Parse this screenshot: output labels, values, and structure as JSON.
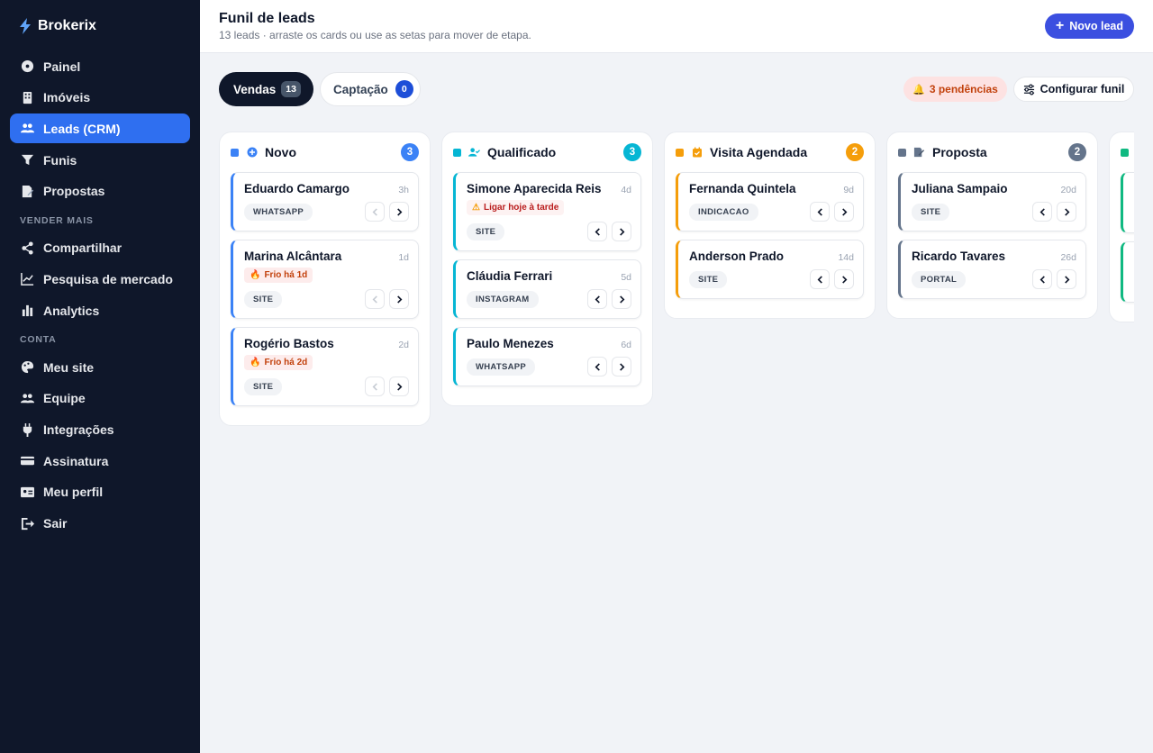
{
  "brand": {
    "name": "Brokerix",
    "icon": "bolt-icon"
  },
  "sidebar": {
    "items": [
      {
        "label": "Painel",
        "icon": "dashboard-icon"
      },
      {
        "label": "Imóveis",
        "icon": "building-icon"
      },
      {
        "label": "Leads (CRM)",
        "icon": "users-icon",
        "active": true
      },
      {
        "label": "Funis",
        "icon": "filter-icon"
      },
      {
        "label": "Propostas",
        "icon": "document-edit-icon"
      }
    ],
    "section_vender": "VENDER MAIS",
    "vender_items": [
      {
        "label": "Compartilhar",
        "icon": "share-icon"
      },
      {
        "label": "Pesquisa de mercado",
        "icon": "chart-line-icon"
      },
      {
        "label": "Analytics",
        "icon": "chart-bar-icon"
      }
    ],
    "section_conta": "CONTA",
    "conta_items": [
      {
        "label": "Meu site",
        "icon": "palette-icon"
      },
      {
        "label": "Equipe",
        "icon": "team-icon"
      },
      {
        "label": "Integrações",
        "icon": "plug-icon"
      },
      {
        "label": "Assinatura",
        "icon": "credit-card-icon"
      },
      {
        "label": "Meu perfil",
        "icon": "id-card-icon"
      },
      {
        "label": "Sair",
        "icon": "logout-icon"
      }
    ]
  },
  "header": {
    "title": "Funil de leads",
    "subtitle": "13 leads · arraste os cards ou use as setas para mover de etapa.",
    "new_lead_label": "Novo lead"
  },
  "toolbar": {
    "tab_vendas": {
      "label": "Vendas",
      "count": "13"
    },
    "tab_captacao": {
      "label": "Captação",
      "count": "0"
    },
    "pendencias_label": "3 pendências",
    "config_label": "Configurar funil"
  },
  "colors": {
    "novo": "#3b82f6",
    "qualificado": "#06b6d4",
    "visita": "#f59e0b",
    "proposta": "#64748b",
    "fechado": "#10b981",
    "primary": "#2f6ff0",
    "sidebar_bg": "#0f172a"
  },
  "columns": [
    {
      "title": "Novo",
      "count": "3",
      "icon": "plus-circle-icon",
      "cards": [
        {
          "name": "Eduardo Camargo",
          "age": "3h",
          "tag": "WHATSAPP",
          "alert": ""
        },
        {
          "name": "Marina Alcântara",
          "age": "1d",
          "tag": "SITE",
          "alert": "Frio há 1d"
        },
        {
          "name": "Rogério Bastos",
          "age": "2d",
          "tag": "SITE",
          "alert": "Frio há 2d"
        }
      ]
    },
    {
      "title": "Qualificado",
      "count": "3",
      "icon": "user-check-icon",
      "cards": [
        {
          "name": "Simone Aparecida Reis",
          "age": "4d",
          "tag": "SITE",
          "alert": "Ligar hoje à tarde"
        },
        {
          "name": "Cláudia Ferrari",
          "age": "5d",
          "tag": "INSTAGRAM",
          "alert": ""
        },
        {
          "name": "Paulo Menezes",
          "age": "6d",
          "tag": "WHATSAPP",
          "alert": ""
        }
      ]
    },
    {
      "title": "Visita Agendada",
      "count": "2",
      "icon": "calendar-check-icon",
      "cards": [
        {
          "name": "Fernanda Quintela",
          "age": "9d",
          "tag": "INDICACAO",
          "alert": ""
        },
        {
          "name": "Anderson Prado",
          "age": "14d",
          "tag": "SITE",
          "alert": ""
        }
      ]
    },
    {
      "title": "Proposta",
      "count": "2",
      "icon": "document-edit-icon",
      "cards": [
        {
          "name": "Juliana Sampaio",
          "age": "20d",
          "tag": "SITE",
          "alert": ""
        },
        {
          "name": "Ricardo Tavares",
          "age": "26d",
          "tag": "PORTAL",
          "alert": ""
        }
      ]
    }
  ]
}
